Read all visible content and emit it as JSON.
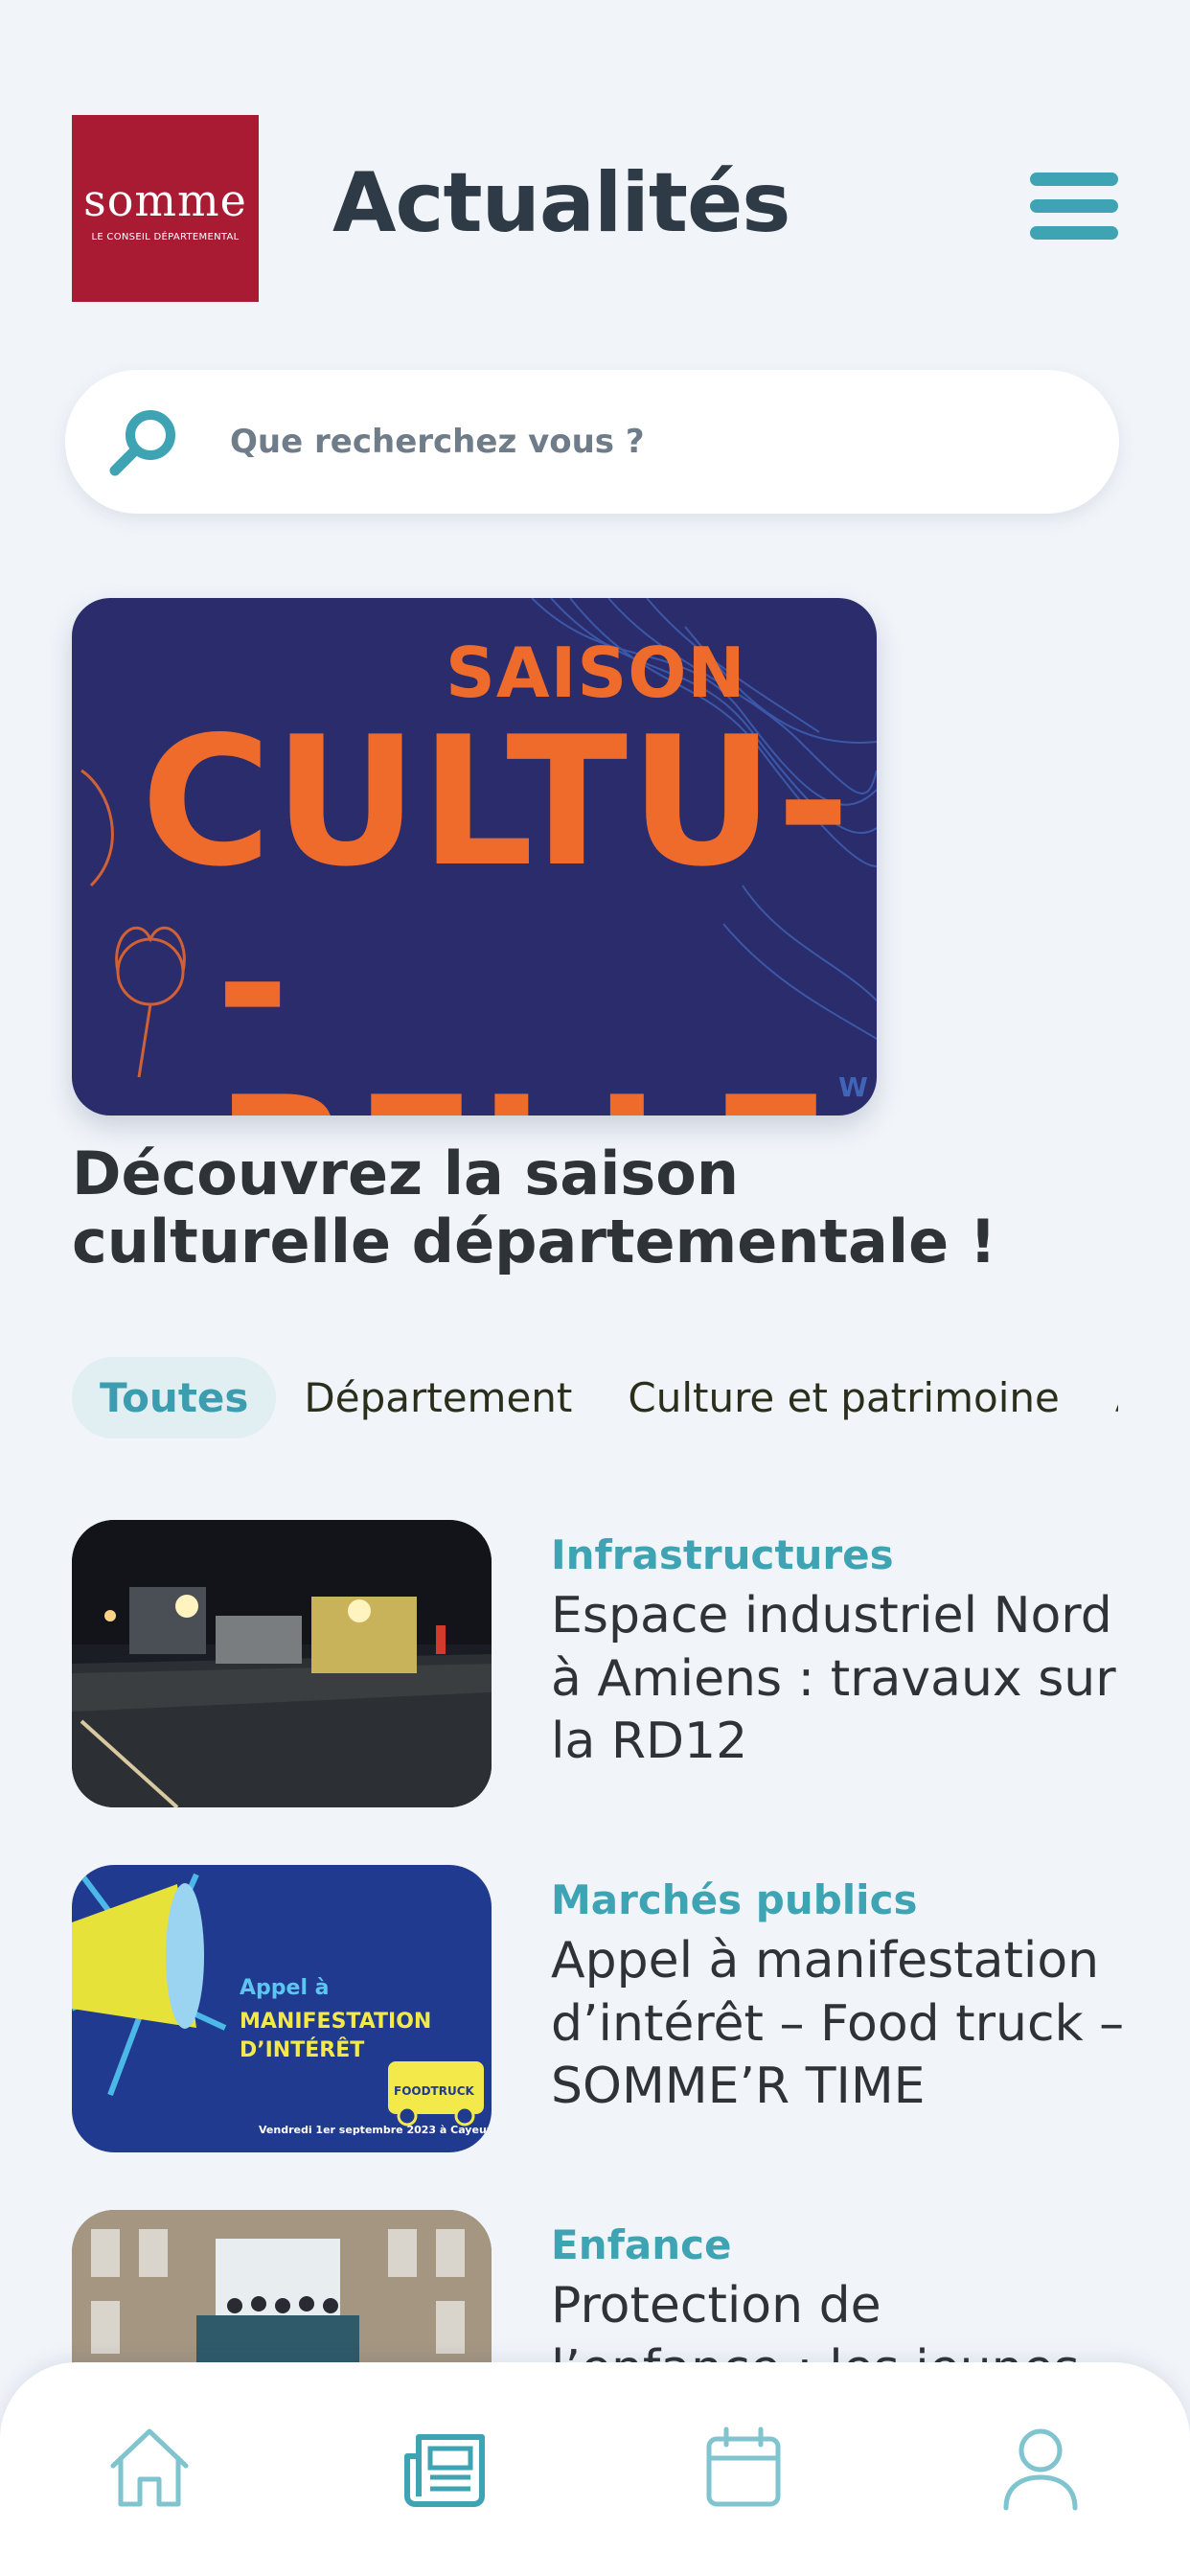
{
  "header": {
    "logo_word": "somme",
    "logo_sub": "LE CONSEIL DÉPARTEMENTAL",
    "title": "Actualités"
  },
  "search": {
    "placeholder": "Que recherchez vous ?"
  },
  "featured": {
    "image_lines": [
      "SAISON",
      "CULTU-",
      "-RELLE"
    ],
    "title": "Découvrez la saison culturelle départementale !"
  },
  "chips": [
    {
      "label": "Toutes",
      "active": true
    },
    {
      "label": "Département",
      "active": false
    },
    {
      "label": "Culture et patrimoine",
      "active": false
    },
    {
      "label": "Agriculture",
      "active": false
    }
  ],
  "articles": [
    {
      "category": "Infrastructures",
      "title": "Espace industriel Nord à Amiens : travaux sur la RD12"
    },
    {
      "category": "Marchés publics",
      "title": "Appel à manifestation d’intérêt – Food truck – SOMME’R TIME",
      "image_text": {
        "line1": "Appel à",
        "line2": "MANIFESTATION",
        "line3": "D’INTÉRÊT",
        "badge": "FOODTRUCK",
        "date": "Vendredi 1er septembre 2023 à Cayeux"
      }
    },
    {
      "category": "Enfance",
      "title": "Protection de l’enfance : les jeunes ont la parole"
    }
  ],
  "nav": [
    {
      "icon": "home-icon",
      "active": false
    },
    {
      "icon": "newspaper-icon",
      "active": true
    },
    {
      "icon": "calendar-icon",
      "active": false
    },
    {
      "icon": "user-icon",
      "active": false
    }
  ],
  "colors": {
    "accent": "#3ea3b3",
    "logo_bg": "#a91a33",
    "featured_bg": "#2b2c6b",
    "featured_text": "#ee6b2c",
    "background": "#f1f5fa"
  }
}
